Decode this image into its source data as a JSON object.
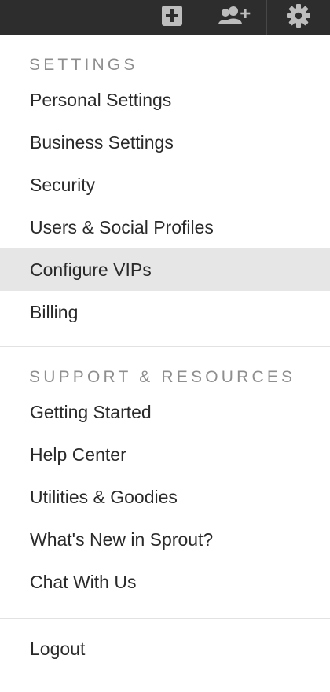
{
  "topbar": {
    "buttons": [
      {
        "icon": "plus-square-icon",
        "label": ""
      },
      {
        "icon": "add-user-icon",
        "label": ""
      },
      {
        "icon": "gear-icon",
        "label": ""
      }
    ],
    "colors": {
      "background": "#2d2d2d",
      "icon": "#bdbdbd",
      "divider": "#474747"
    }
  },
  "menu": {
    "settings": {
      "heading": "SETTINGS",
      "items": [
        {
          "label": "Personal Settings"
        },
        {
          "label": "Business Settings"
        },
        {
          "label": "Security"
        },
        {
          "label": "Users & Social Profiles"
        },
        {
          "label": "Configure VIPs",
          "active": true
        },
        {
          "label": "Billing"
        }
      ]
    },
    "support": {
      "heading": "SUPPORT & RESOURCES",
      "items": [
        {
          "label": "Getting Started"
        },
        {
          "label": "Help Center"
        },
        {
          "label": "Utilities & Goodies"
        },
        {
          "label": "What's New in Sprout?"
        },
        {
          "label": "Chat With Us"
        }
      ]
    },
    "logout": {
      "label": "Logout"
    },
    "colors": {
      "heading": "#8e8e8e",
      "item_text": "#2a2a2a",
      "active_bg": "#e6e6e6"
    }
  }
}
